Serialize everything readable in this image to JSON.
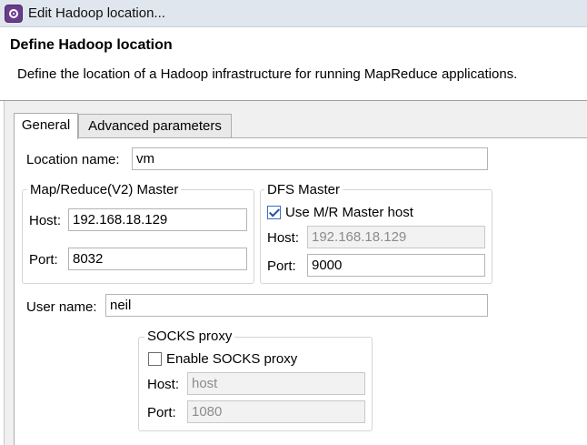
{
  "window": {
    "title": "Edit Hadoop location...",
    "icon": "eclipse-icon"
  },
  "header": {
    "title": "Define Hadoop location",
    "description": "Define the location of a Hadoop infrastructure for running MapReduce applications."
  },
  "tabs": [
    {
      "label": "General",
      "active": true
    },
    {
      "label": "Advanced parameters",
      "active": false
    }
  ],
  "general": {
    "location_name": {
      "label": "Location name:",
      "value": "vm"
    },
    "mr_master": {
      "legend": "Map/Reduce(V2) Master",
      "host_label": "Host:",
      "host_value": "192.168.18.129",
      "port_label": "Port:",
      "port_value": "8032"
    },
    "dfs_master": {
      "legend": "DFS Master",
      "use_mr_host_label": "Use M/R Master host",
      "use_mr_host_checked": true,
      "host_label": "Host:",
      "host_value": "192.168.18.129",
      "port_label": "Port:",
      "port_value": "9000"
    },
    "user_name": {
      "label": "User name:",
      "value": "neil"
    },
    "socks_proxy": {
      "legend": "SOCKS proxy",
      "enable_label": "Enable SOCKS proxy",
      "enable_checked": false,
      "host_label": "Host:",
      "host_value": "host",
      "port_label": "Port:",
      "port_value": "1080"
    }
  }
}
